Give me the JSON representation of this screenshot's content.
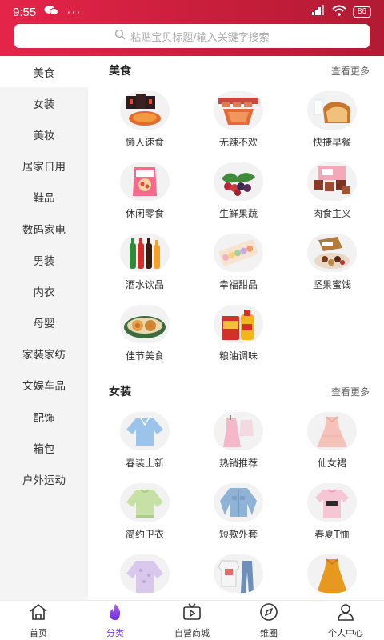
{
  "status": {
    "time": "9:55",
    "dots": "···",
    "battery": "86"
  },
  "search": {
    "placeholder": "粘贴宝贝标题/输入关键字搜索"
  },
  "sidebar": {
    "items": [
      {
        "label": "美食",
        "active": true
      },
      {
        "label": "女装"
      },
      {
        "label": "美妆"
      },
      {
        "label": "居家日用"
      },
      {
        "label": "鞋品"
      },
      {
        "label": "数码家电"
      },
      {
        "label": "男装"
      },
      {
        "label": "内衣"
      },
      {
        "label": "母婴"
      },
      {
        "label": "家装家纺"
      },
      {
        "label": "文娱车品"
      },
      {
        "label": "配饰"
      },
      {
        "label": "箱包"
      },
      {
        "label": "户外运动"
      }
    ]
  },
  "sections": [
    {
      "title": "美食",
      "more": "查看更多",
      "items": [
        {
          "label": "懒人速食",
          "icon": "noodles-icon"
        },
        {
          "label": "无辣不欢",
          "icon": "spicy-meat-icon"
        },
        {
          "label": "快捷早餐",
          "icon": "bread-icon"
        },
        {
          "label": "休闲零食",
          "icon": "snack-bag-icon"
        },
        {
          "label": "生鲜果蔬",
          "icon": "fruit-icon"
        },
        {
          "label": "肉食主义",
          "icon": "beef-icon"
        },
        {
          "label": "酒水饮品",
          "icon": "bottles-icon"
        },
        {
          "label": "幸福甜品",
          "icon": "macaron-icon"
        },
        {
          "label": "坚果蜜饯",
          "icon": "nuts-icon"
        },
        {
          "label": "佳节美食",
          "icon": "mooncake-icon"
        },
        {
          "label": "粮油调味",
          "icon": "oil-rice-icon"
        }
      ]
    },
    {
      "title": "女装",
      "more": "查看更多",
      "items": [
        {
          "label": "春装上新",
          "icon": "blouse-icon"
        },
        {
          "label": "热销推荐",
          "icon": "dress-set-icon"
        },
        {
          "label": "仙女裙",
          "icon": "fairy-dress-icon"
        },
        {
          "label": "简约卫衣",
          "icon": "sweatshirt-icon"
        },
        {
          "label": "短款外套",
          "icon": "denim-jacket-icon"
        },
        {
          "label": "春夏T恤",
          "icon": "tshirt-icon"
        },
        {
          "label": "",
          "icon": "lace-top-icon"
        },
        {
          "label": "",
          "icon": "outfit-icon"
        },
        {
          "label": "",
          "icon": "orange-dress-icon"
        }
      ]
    }
  ],
  "tabs": [
    {
      "label": "首页",
      "icon": "home-icon"
    },
    {
      "label": "分类",
      "icon": "flame-icon",
      "active": true
    },
    {
      "label": "自营商城",
      "icon": "tv-icon"
    },
    {
      "label": "维圈",
      "icon": "compass-icon"
    },
    {
      "label": "个人中心",
      "icon": "user-icon"
    }
  ],
  "colors": {
    "brand": "#d5213f",
    "active_tab": "#7b3bf0"
  }
}
